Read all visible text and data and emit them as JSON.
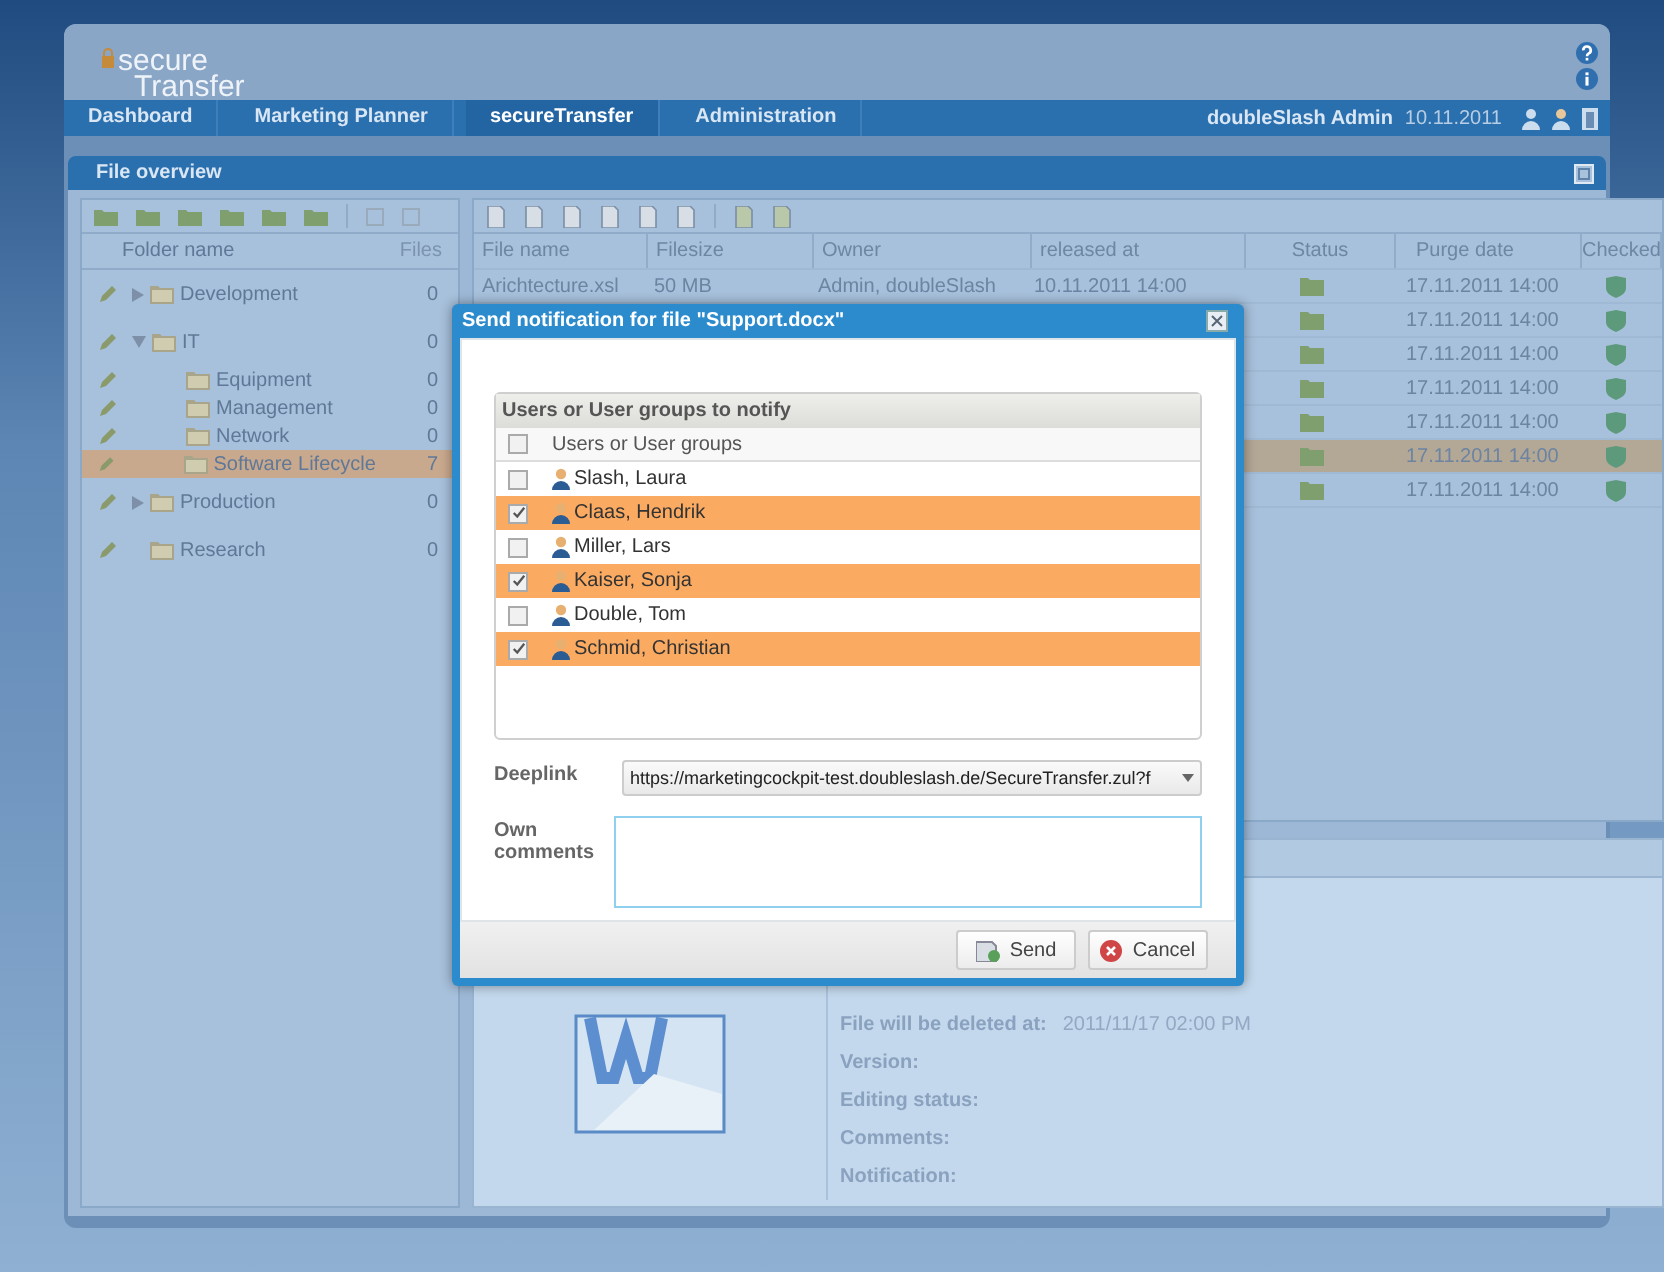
{
  "header": {
    "logo_top": "secure",
    "logo_bottom": "Transfer"
  },
  "nav": {
    "items": [
      {
        "label": "Dashboard",
        "selected": false
      },
      {
        "label": "Marketing Planner",
        "selected": false
      },
      {
        "label": "secureTransfer",
        "selected": true
      },
      {
        "label": "Administration",
        "selected": false
      }
    ],
    "user": "doubleSlash Admin",
    "date": "10.11.2011"
  },
  "panel": {
    "title": "File overview"
  },
  "folders": {
    "columns": [
      "Folder name",
      "Files"
    ],
    "items": [
      {
        "name": "Development",
        "files": "0",
        "kind": "branch",
        "expanded": false,
        "selected": false
      },
      {
        "name": "IT",
        "files": "0",
        "kind": "branch",
        "expanded": true,
        "selected": false,
        "children": [
          {
            "name": "Equipment",
            "files": "0",
            "kind": "leaf",
            "selected": false
          },
          {
            "name": "Management",
            "files": "0",
            "kind": "leaf",
            "selected": false
          },
          {
            "name": "Network",
            "files": "0",
            "kind": "leaf",
            "selected": false
          },
          {
            "name": "Software Lifecycle",
            "files": "7",
            "kind": "leaf",
            "selected": true
          }
        ]
      },
      {
        "name": "Production",
        "files": "0",
        "kind": "branch",
        "expanded": false,
        "selected": false
      },
      {
        "name": "Research",
        "files": "0",
        "kind": "leaf",
        "selected": false
      }
    ]
  },
  "files": {
    "columns": [
      "File name",
      "Filesize",
      "Owner",
      "released at",
      "Status",
      "Purge date",
      "Checked"
    ],
    "rows": [
      {
        "file_name": "Arichtecture.xsl",
        "filesize": "50 MB",
        "owner": "Admin, doubleSlash",
        "released_at": "10.11.2011 14:00",
        "purge_date": "17.11.2011 14:00",
        "selected": false
      },
      {
        "purge_date": "17.11.2011 14:00",
        "selected": false
      },
      {
        "purge_date": "17.11.2011 14:00",
        "selected": false
      },
      {
        "purge_date": "17.11.2011 14:00",
        "selected": false
      },
      {
        "purge_date": "17.11.2011 14:00",
        "selected": false
      },
      {
        "purge_date": "17.11.2011 14:00",
        "selected": true
      },
      {
        "purge_date": "17.11.2011 14:00",
        "selected": false
      }
    ]
  },
  "details": {
    "fields": [
      {
        "label": "File will be deleted at:",
        "value": "2011/11/17 02:00 PM"
      },
      {
        "label": "Version:"
      },
      {
        "label": "Editing status:"
      },
      {
        "label": "Comments:"
      },
      {
        "label": "Notification:"
      }
    ]
  },
  "dialog": {
    "title": "Send notification for file \"Support.docx\"",
    "group_title": "Users or User groups to notify",
    "column_header": "Users or User groups",
    "all_checked": false,
    "users": [
      {
        "name": "Slash, Laura",
        "checked": false
      },
      {
        "name": "Claas, Hendrik",
        "checked": true
      },
      {
        "name": "Miller, Lars",
        "checked": false
      },
      {
        "name": "Kaiser, Sonja",
        "checked": true
      },
      {
        "name": "Double, Tom",
        "checked": false
      },
      {
        "name": "Schmid, Christian",
        "checked": true
      }
    ],
    "deeplink_label": "Deeplink",
    "deeplink_value": "https://marketingcockpit-test.doubleslash.de/SecureTransfer.zul?f",
    "comments_label": "Own comments",
    "buttons": [
      {
        "label": "Send",
        "kind": "send"
      },
      {
        "label": "Cancel",
        "kind": "cancel"
      }
    ]
  }
}
